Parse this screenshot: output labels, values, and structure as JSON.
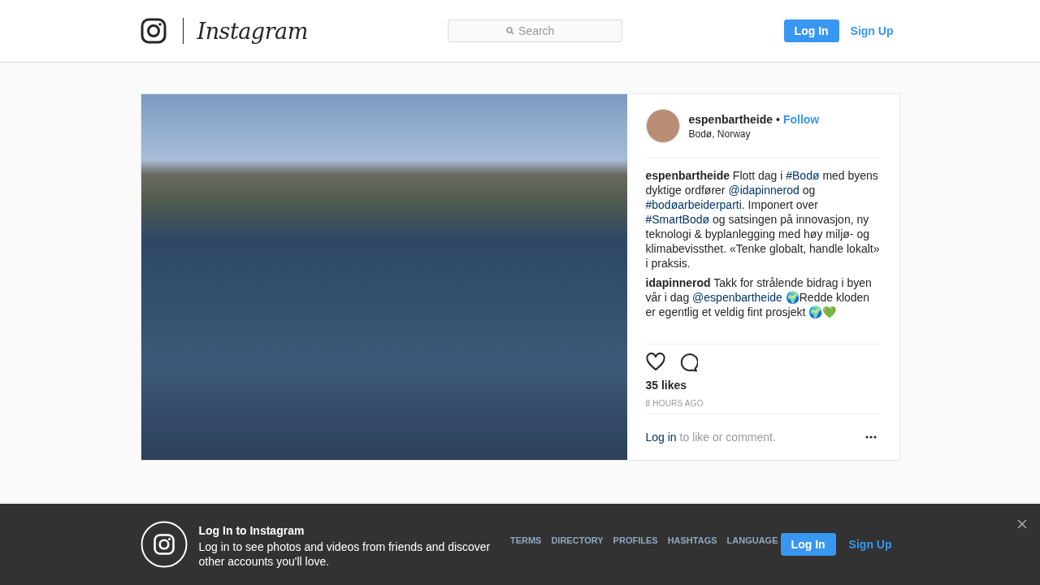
{
  "header": {
    "logo_text": "Instagram",
    "search": {
      "placeholder": "Search"
    },
    "buttons": [
      {
        "label": "Log In",
        "kind": "primary"
      },
      {
        "label": "Sign Up",
        "kind": "link"
      }
    ]
  },
  "post": {
    "author": {
      "username": "espenbartheide",
      "separator": "•",
      "follow": "Follow",
      "location": "Bodø, Norway"
    },
    "comments": [
      {
        "parts": [
          {
            "kind": "user",
            "text": "espenbartheide"
          },
          {
            "kind": "text",
            "text": " Flott dag i "
          },
          {
            "kind": "tag",
            "text": "#Bodø"
          },
          {
            "kind": "text",
            "text": " med byens dyktige ordfører "
          },
          {
            "kind": "mention",
            "text": "@idapinnerod"
          },
          {
            "kind": "text",
            "text": " og "
          },
          {
            "kind": "tag",
            "text": "#bodøarbeiderparti"
          },
          {
            "kind": "text",
            "text": ". Imponert over "
          },
          {
            "kind": "tag",
            "text": "#SmartBodø"
          },
          {
            "kind": "text",
            "text": " og satsingen på innovasjon, ny teknologi & byplanlegging med høy miljø- og klimabevissthet. «Tenke globalt, handle lokalt» i praksis."
          }
        ]
      },
      {
        "parts": [
          {
            "kind": "user",
            "text": "idapinnerod"
          },
          {
            "kind": "text",
            "text": " Takk for strålende bidrag i byen vår i dag "
          },
          {
            "kind": "mention",
            "text": "@espenbartheide"
          },
          {
            "kind": "text",
            "text": " 🌍Redde kloden er egentlig et veldig fint prosjekt 🌍💚"
          }
        ]
      }
    ],
    "likes": "35 likes",
    "time": "8 HOURS AGO",
    "login_prompt": {
      "link": "Log in",
      "text": " to like or comment."
    }
  },
  "footer": {
    "links": [
      "TERMS",
      "DIRECTORY",
      "PROFILES",
      "HASHTAGS",
      "LANGUAGE"
    ]
  },
  "banner": {
    "title": "Log In to Instagram",
    "text": "Log in to see photos and videos from friends and discover other accounts you'll love.",
    "buttons": [
      {
        "label": "Log In",
        "kind": "primary"
      },
      {
        "label": "Sign Up",
        "kind": "link"
      }
    ]
  }
}
